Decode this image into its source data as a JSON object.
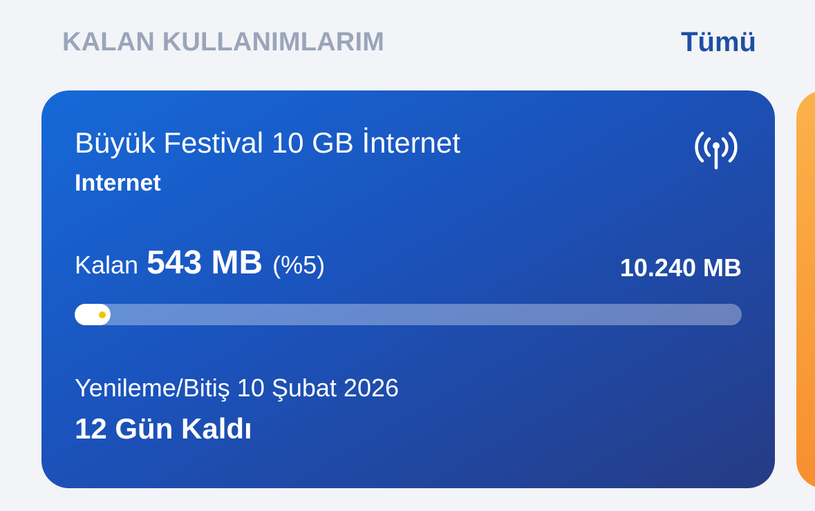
{
  "header": {
    "title": "KALAN KULLANIMLARIM",
    "see_all_label": "Tümü"
  },
  "card": {
    "package_name": "Büyük Festival 10 GB İnternet",
    "package_type": "Internet",
    "icon": "signal-tower-icon",
    "remaining_label": "Kalan",
    "remaining_value": "543 MB",
    "remaining_percent": "(%5)",
    "total_value": "10.240 MB",
    "progress_fraction": 0.053,
    "renewal_text": "Yenileme/Bitiş 10 Şubat 2026",
    "days_left_text": "12 Gün Kaldı"
  },
  "colors": {
    "card_start": "#1669d9",
    "card_end": "#263b84",
    "next_card": "#f78f2e",
    "accent": "#1e4fa3",
    "dot": "#f2c400"
  }
}
